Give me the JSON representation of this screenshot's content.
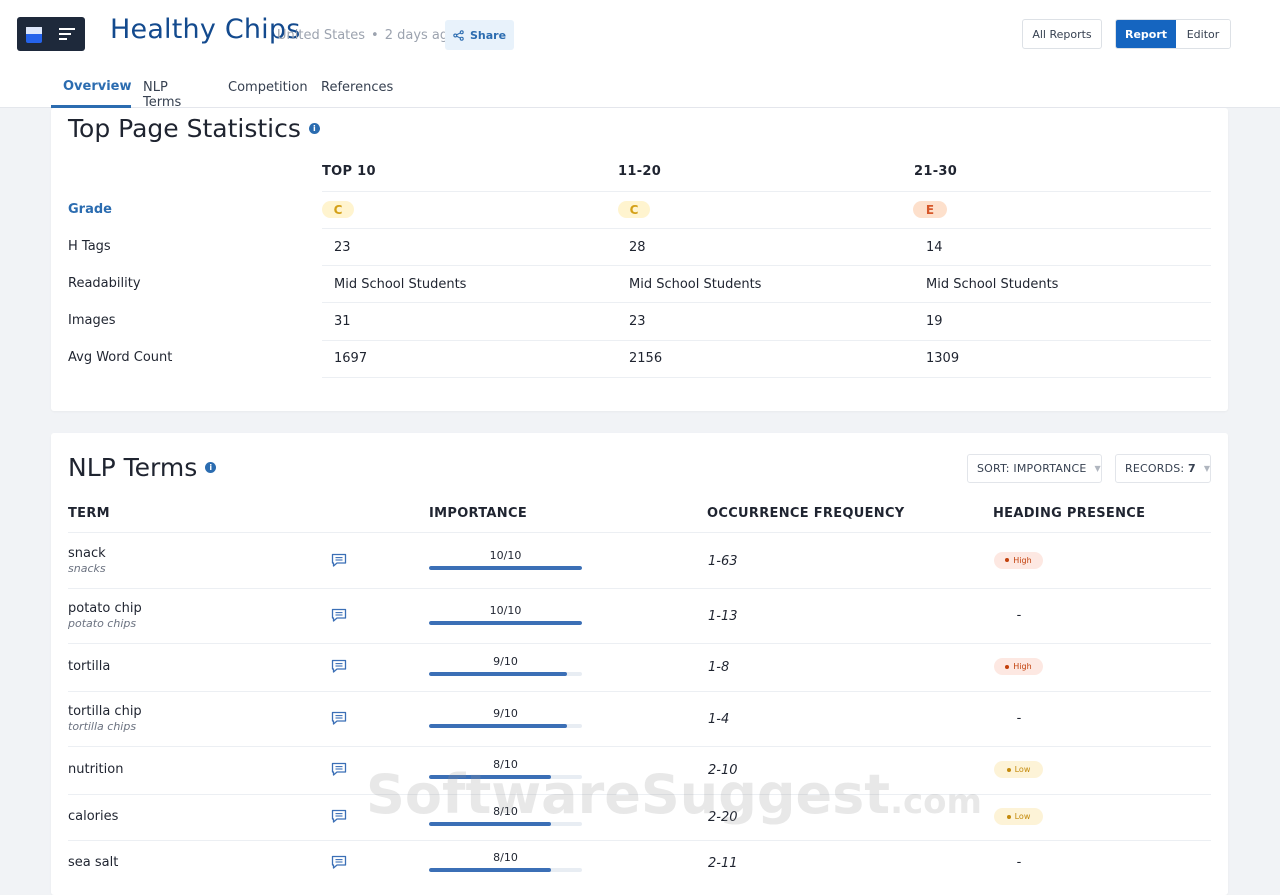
{
  "header": {
    "title": "Healthy Chips",
    "location": "United States",
    "separator": "•",
    "age": "2 days ago",
    "share_label": "Share",
    "all_reports_label": "All Reports",
    "report_label": "Report",
    "editor_label": "Editor"
  },
  "tabs": [
    "Overview",
    "NLP Terms",
    "Competition",
    "References"
  ],
  "stats": {
    "title": "Top Page Statistics",
    "columns": [
      "TOP 10",
      "11-20",
      "21-30"
    ],
    "rows": [
      {
        "label": "Grade",
        "values": [
          "C",
          "C",
          "E"
        ]
      },
      {
        "label": "H Tags",
        "values": [
          "23",
          "28",
          "14"
        ]
      },
      {
        "label": "Readability",
        "values": [
          "Mid School Students",
          "Mid School Students",
          "Mid School Students"
        ]
      },
      {
        "label": "Images",
        "values": [
          "31",
          "23",
          "19"
        ]
      },
      {
        "label": "Avg Word Count",
        "values": [
          "1697",
          "2156",
          "1309"
        ]
      }
    ]
  },
  "nlp": {
    "title": "NLP Terms",
    "sort_label": "SORT: IMPORTANCE",
    "records_label": "RECORDS:",
    "records_value": "7",
    "columns": [
      "TERM",
      "IMPORTANCE",
      "OCCURRENCE FREQUENCY",
      "HEADING PRESENCE"
    ],
    "rows": [
      {
        "term": "snack",
        "sub": "snacks",
        "importance": "10/10",
        "fill": 1.0,
        "freq": "1-63",
        "presence": "High"
      },
      {
        "term": "potato chip",
        "sub": "potato chips",
        "importance": "10/10",
        "fill": 1.0,
        "freq": "1-13",
        "presence": "-"
      },
      {
        "term": "tortilla",
        "sub": "",
        "importance": "9/10",
        "fill": 0.9,
        "freq": "1-8",
        "presence": "High"
      },
      {
        "term": "tortilla chip",
        "sub": "tortilla chips",
        "importance": "9/10",
        "fill": 0.9,
        "freq": "1-4",
        "presence": "-"
      },
      {
        "term": "nutrition",
        "sub": "",
        "importance": "8/10",
        "fill": 0.8,
        "freq": "2-10",
        "presence": "Low"
      },
      {
        "term": "calories",
        "sub": "",
        "importance": "8/10",
        "fill": 0.8,
        "freq": "2-20",
        "presence": "Low"
      },
      {
        "term": "sea salt",
        "sub": "",
        "importance": "8/10",
        "fill": 0.8,
        "freq": "2-11",
        "presence": "-"
      }
    ]
  },
  "watermark": {
    "text": "SoftwareSuggest",
    "suffix": ".com"
  },
  "colors": {
    "brand": "#134a8e",
    "accent": "#1565c0",
    "bar": "#3b6fb6",
    "high": "#c2410c",
    "low": "#c48a0c"
  }
}
